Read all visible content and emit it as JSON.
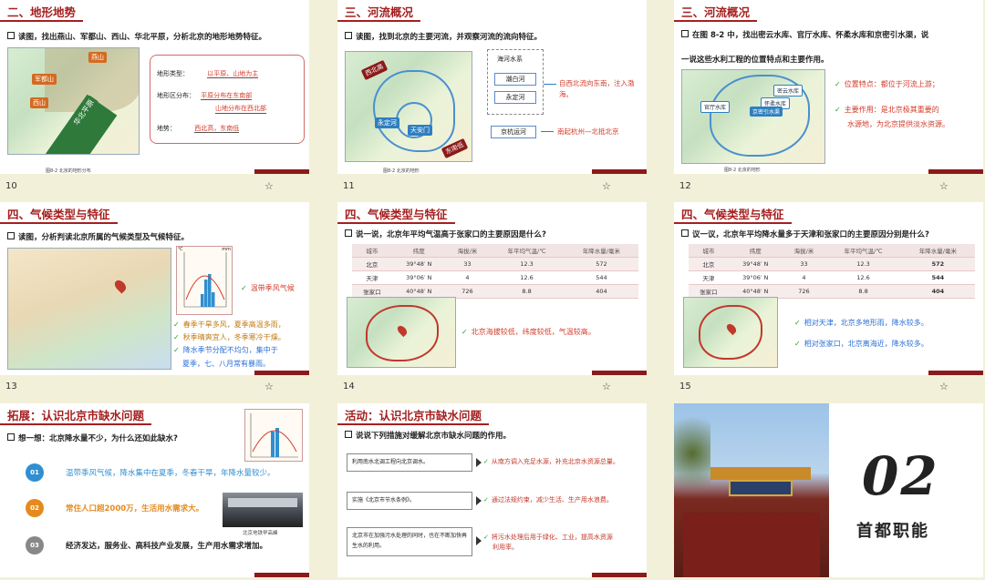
{
  "slides": [
    {
      "id": 10,
      "title": "二、地形地势",
      "question": "读图，找出燕山、军都山、西山、华北平原，分析北京的地形地势特征。",
      "map_tags": [
        "燕山",
        "军都山",
        "西山",
        "华北平原"
      ],
      "caption": "图8-2 北京的地形分布",
      "items": [
        {
          "label": "地形类型：",
          "value": "以平原、山地为主"
        },
        {
          "label": "地形区分布：",
          "value": "平原分布在东南部",
          "value2": "山地分布在西北部"
        },
        {
          "label": "地势：",
          "value": "西北高，东南低"
        }
      ]
    },
    {
      "id": 11,
      "title": "三、河流概况",
      "question": "读图，找到北京的主要河流，并观察河流的流向特征。",
      "map_tags": [
        "西北高",
        "永定河",
        "东南低",
        "天安门"
      ],
      "caption": "图8-2 北京的地形",
      "system_label": "海河水系",
      "rivers": [
        "潮白河",
        "永定河"
      ],
      "flow": "自西北流向东南，注入渤海。",
      "canal": "京杭运河",
      "canal_note": "南起杭州—北抵北京"
    },
    {
      "id": 12,
      "title": "三、河流概况",
      "question": "在图 8-2 中，找出密云水库、官厅水库、怀柔水库和京密引水渠，说",
      "question2": "一说这些水利工程的位置特点和主要作用。",
      "map_tags": [
        "官厅水库",
        "怀柔水库",
        "京密引水渠",
        "密云水库"
      ],
      "caption": "图8-2 北京的地形",
      "points": [
        {
          "text": "位置特点：都位于河流上游；"
        },
        {
          "text": "主要作用：是北京极其重要的",
          "text2": "水源地，为北京提供淡水资源。"
        }
      ]
    },
    {
      "id": 13,
      "title": "四、气候类型与特征",
      "question": "读图，分析判读北京所属的气候类型及气候特征。",
      "climate_type": "温带季风气候",
      "features": [
        {
          "text": "春季干旱多风，夏季高温多雨，",
          "color": "orange"
        },
        {
          "text": "秋季晴爽宜人，冬季寒冷干燥。",
          "color": "orange"
        },
        {
          "text": "降水季节分配不均匀，集中于",
          "color": "blue"
        },
        {
          "text": "夏季，七、八月常有暴雨。",
          "color": "blue"
        }
      ],
      "chart_axis_left": "℃",
      "chart_axis_right": "mm"
    },
    {
      "id": 14,
      "title": "四、气候类型与特征",
      "question": "说一说，北京年平均气温高于张家口的主要原因是什么?",
      "table": {
        "headers": [
          "城市",
          "纬度",
          "海拔/米",
          "年平均气温/℃",
          "年降水量/毫米"
        ],
        "rows": [
          [
            "北京",
            "39°48′ N",
            "33",
            "12.3",
            "572"
          ],
          [
            "天津",
            "39°06′ N",
            "4",
            "12.6",
            "544"
          ],
          [
            "张家口",
            "40°48′ N",
            "726",
            "8.8",
            "404"
          ]
        ]
      },
      "answer": "北京海拔较低，纬度较低，气温较高。"
    },
    {
      "id": 15,
      "title": "四、气候类型与特征",
      "question": "议一议，北京年平均降水量多于天津和张家口的主要原因分别是什么?",
      "table": {
        "headers": [
          "城市",
          "纬度",
          "海拔/米",
          "年平均气温/℃",
          "年降水量/毫米"
        ],
        "rows": [
          [
            "北京",
            "39°48′ N",
            "33",
            "12.3",
            "572"
          ],
          [
            "天津",
            "39°06′ N",
            "4",
            "12.6",
            "544"
          ],
          [
            "张家口",
            "40°48′ N",
            "726",
            "8.8",
            "404"
          ]
        ]
      },
      "answers": [
        "相对天津，北京多地形雨，降水较多。",
        "相对张家口，北京离海近，降水较多。"
      ]
    },
    {
      "id": 16,
      "title": "拓展：认识北京市缺水问题",
      "question": "想一想：北京降水量不少，为什么还如此缺水?",
      "items": [
        {
          "num": "01",
          "text": "温带季风气候，降水集中在夏季，冬春干旱，年降水量较少。",
          "color": "#2f8fd0"
        },
        {
          "num": "02",
          "text": "常住人口超2000万，生活用水需求大。",
          "color": "#e58a1f"
        },
        {
          "num": "03",
          "text": "经济发达，服务业、高科技产业发展，生产用水需求增加。",
          "color": "#888888"
        }
      ],
      "photo_caption": "北京地铁早高峰"
    },
    {
      "id": 17,
      "title": "活动：认识北京市缺水问题",
      "question": "说说下列措施对缓解北京市缺水问题的作用。",
      "measures": [
        {
          "text": "利用南水北调工程向北京调水。",
          "result": "从南方调入充足水源，补充北京水资源总量。"
        },
        {
          "text": "实施《北京市节水条例》。",
          "result": "通过法规约束，减少生活、生产用水浪费。"
        },
        {
          "text": "北京市在加强污水处理的同时，也在不断加快再生水的利用。",
          "result": "将污水处理后用于绿化、工业，提高水资源",
          "result2": "利用率。"
        }
      ]
    },
    {
      "id": 18,
      "big_number": "02",
      "subtitle": "首都职能"
    }
  ]
}
